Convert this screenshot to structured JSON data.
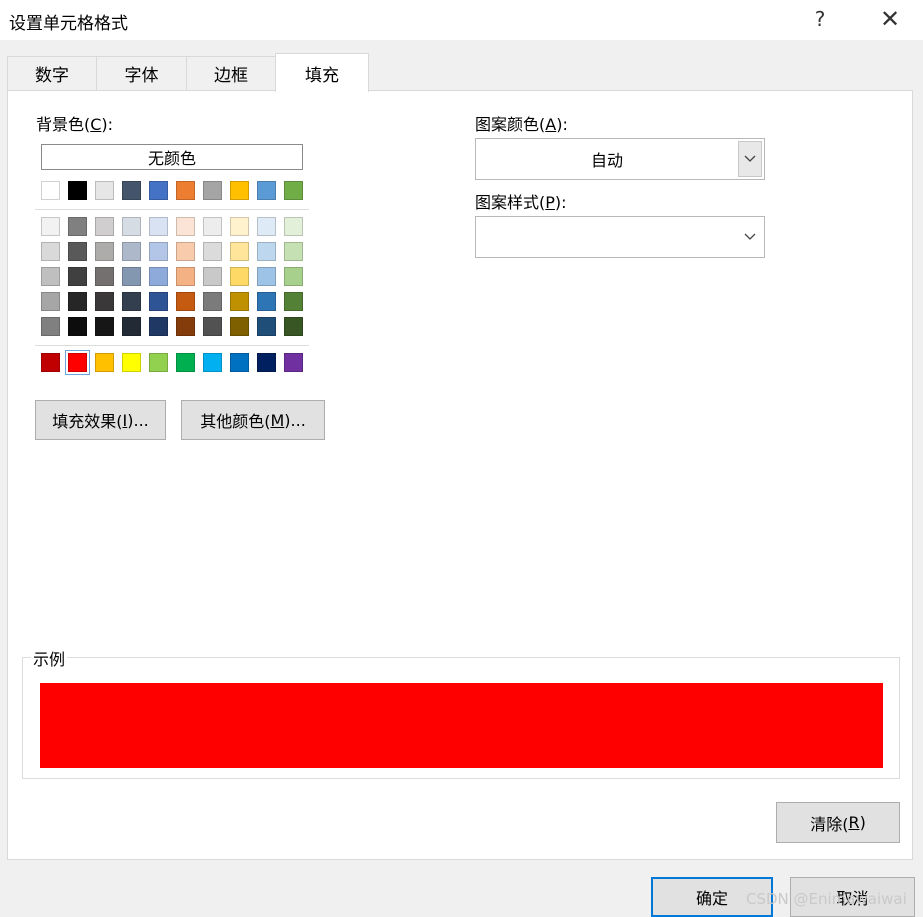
{
  "window": {
    "title": "设置单元格格式",
    "help": "?",
    "close": "✕"
  },
  "tabs": [
    {
      "label": "数字"
    },
    {
      "label": "字体"
    },
    {
      "label": "边框"
    },
    {
      "label": "填充",
      "active": true
    }
  ],
  "fill": {
    "bg_label_pre": "背景色(",
    "bg_label_key": "C",
    "bg_label_post": "):",
    "no_color": "无颜色",
    "theme_row": [
      "#ffffff",
      "#000000",
      "#e7e6e6",
      "#44546a",
      "#4472c4",
      "#ed7d31",
      "#a5a5a5",
      "#ffc000",
      "#5b9bd5",
      "#70ad47"
    ],
    "shade_rows": [
      [
        "#f2f2f2",
        "#808080",
        "#d0cece",
        "#d6dce4",
        "#d9e2f3",
        "#fbe4d5",
        "#ededed",
        "#fff2cc",
        "#deebf6",
        "#e2efd9"
      ],
      [
        "#d9d9d9",
        "#595959",
        "#aeabab",
        "#adb9ca",
        "#b4c6e7",
        "#f8cbad",
        "#dbdbdb",
        "#ffe599",
        "#bdd7ee",
        "#c5e0b3"
      ],
      [
        "#bfbfbf",
        "#404040",
        "#757070",
        "#8497b0",
        "#8eaadb",
        "#f4b183",
        "#c9c9c9",
        "#ffd966",
        "#9dc3e6",
        "#a8d08d"
      ],
      [
        "#a6a6a6",
        "#262626",
        "#3a3838",
        "#333f4f",
        "#2f5496",
        "#c55a11",
        "#7b7b7b",
        "#bf9000",
        "#2e75b5",
        "#538135"
      ],
      [
        "#808080",
        "#0d0d0d",
        "#171616",
        "#222a35",
        "#1f3864",
        "#843c0b",
        "#525252",
        "#7f6000",
        "#1f4e79",
        "#375623"
      ]
    ],
    "standard_row": [
      "#c00000",
      "#ff0000",
      "#ffc000",
      "#ffff00",
      "#92d050",
      "#00b050",
      "#00b0f0",
      "#0070c0",
      "#002060",
      "#7030a0"
    ],
    "selected_color": "#ff0000",
    "fill_effects_pre": "填充效果(",
    "fill_effects_key": "I",
    "fill_effects_post": ")...",
    "more_colors_pre": "其他颜色(",
    "more_colors_key": "M",
    "more_colors_post": ")...",
    "pattern_color_pre": "图案颜色(",
    "pattern_color_key": "A",
    "pattern_color_post": "):",
    "pattern_color_value": "自动",
    "pattern_style_pre": "图案样式(",
    "pattern_style_key": "P",
    "pattern_style_post": "):",
    "pattern_style_value": "",
    "sample_label": "示例",
    "clear_pre": "清除(",
    "clear_key": "R",
    "clear_post": ")"
  },
  "footer": {
    "ok": "确定",
    "cancel": "取消"
  },
  "watermark": "CSDN @Enimawaiwai",
  "icons": {
    "dropdown": "chevron-down-icon"
  }
}
